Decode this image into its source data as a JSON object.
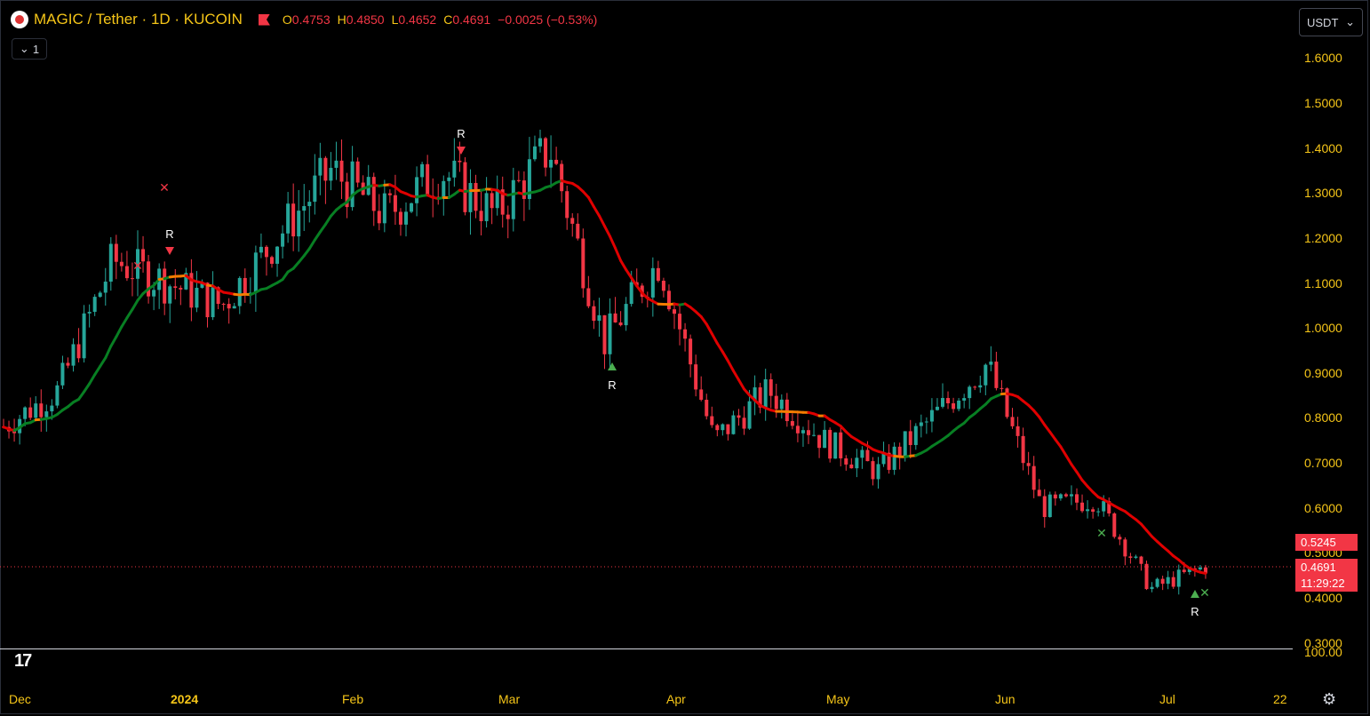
{
  "legend": {
    "symbol": "MAGIC / Tether · 1D · KUCOIN",
    "open_k": "O",
    "open": "0.4753",
    "high_k": "H",
    "high": "0.4850",
    "low_k": "L",
    "low": "0.4652",
    "close_k": "C",
    "close": "0.4691",
    "change": "−0.0025 (−0.53%)"
  },
  "collapse_label": "1",
  "currency": "USDT",
  "price_axis": [
    "1.6000",
    "1.5000",
    "1.4000",
    "1.3000",
    "1.2000",
    "1.1000",
    "1.0000",
    "0.9000",
    "0.8000",
    "0.7000",
    "0.6000",
    "0.5000",
    "0.4000",
    "0.3000"
  ],
  "indicator_axis": "100.00",
  "time_axis": [
    {
      "label": "Dec",
      "bold": false
    },
    {
      "label": "2024",
      "bold": true
    },
    {
      "label": "Feb",
      "bold": false
    },
    {
      "label": "Mar",
      "bold": false
    },
    {
      "label": "Apr",
      "bold": false
    },
    {
      "label": "May",
      "bold": false
    },
    {
      "label": "Jun",
      "bold": false
    },
    {
      "label": "Jul",
      "bold": false
    },
    {
      "label": "22",
      "bold": false
    }
  ],
  "badges": {
    "ma_value": "0.5245",
    "last_price": "0.4691",
    "countdown": "11:29:22"
  },
  "markers": [
    "R",
    "R",
    "R",
    "R"
  ],
  "colors": {
    "up": "#26a69a",
    "down": "#f23645",
    "bull_line": "#087f23",
    "bear_line": "#e00000",
    "neutral_line": "#f57c00",
    "axis_text": "#f5c518"
  },
  "chart_data": {
    "type": "candlestick",
    "ylim": [
      0.3,
      1.6
    ],
    "last_price": 0.4691,
    "ma_last": 0.5245,
    "approx_closes": [
      {
        "x": "Dec",
        "y": 0.78
      },
      {
        "x": "mid-Dec",
        "y": 0.86
      },
      {
        "x": "late-Dec",
        "y": 1.15
      },
      {
        "x": "2024",
        "y": 1.1
      },
      {
        "x": "mid-Jan",
        "y": 1.05
      },
      {
        "x": "late-Jan",
        "y": 1.2
      },
      {
        "x": "Feb",
        "y": 1.35
      },
      {
        "x": "mid-Feb",
        "y": 1.25
      },
      {
        "x": "late-Feb",
        "y": 1.35
      },
      {
        "x": "Mar",
        "y": 1.25
      },
      {
        "x": "mid-Mar",
        "y": 1.4
      },
      {
        "x": "late-Mar",
        "y": 0.97
      },
      {
        "x": "Apr",
        "y": 1.15
      },
      {
        "x": "mid-Apr",
        "y": 0.75
      },
      {
        "x": "late-Apr",
        "y": 0.86
      },
      {
        "x": "May",
        "y": 0.75
      },
      {
        "x": "mid-May",
        "y": 0.68
      },
      {
        "x": "late-May",
        "y": 0.8
      },
      {
        "x": "Jun",
        "y": 0.92
      },
      {
        "x": "mid-Jun",
        "y": 0.6
      },
      {
        "x": "late-Jun",
        "y": 0.62
      },
      {
        "x": "Jul",
        "y": 0.42
      },
      {
        "x": "mid-Jul",
        "y": 0.4691
      }
    ]
  }
}
